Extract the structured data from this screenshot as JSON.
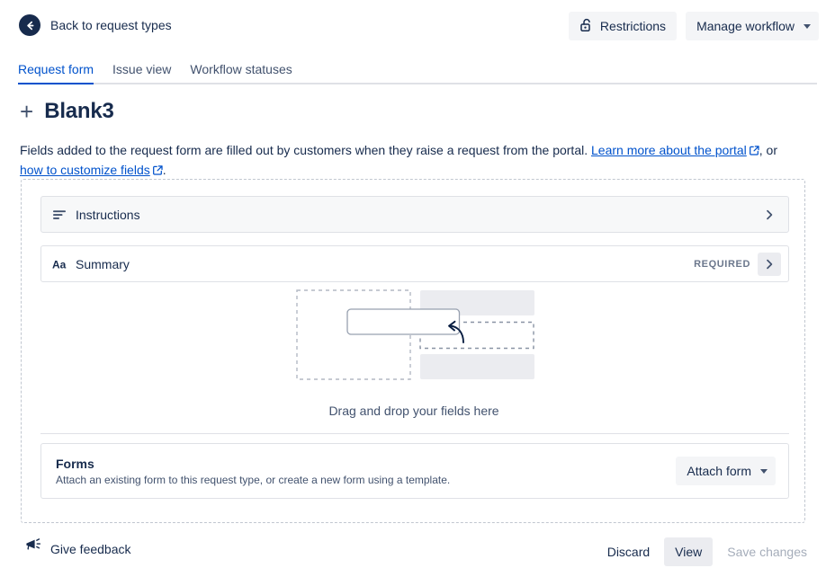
{
  "topbar": {
    "back_label": "Back to request types",
    "back_icon": "arrow-left-circle-icon",
    "restrictions_label": "Restrictions",
    "restrictions_icon": "unlock-icon",
    "manage_workflow_label": "Manage workflow",
    "manage_workflow_icon": "chevron-down-icon"
  },
  "tabs": [
    {
      "label": "Request form",
      "active": true
    },
    {
      "label": "Issue view",
      "active": false
    },
    {
      "label": "Workflow statuses",
      "active": false
    }
  ],
  "heading": {
    "plus_icon": "plus-icon",
    "title": "Blank3"
  },
  "description": {
    "part1": "Fields added to the request form are filled out by customers when they raise a request from the portal. ",
    "link1": "Learn more about the portal",
    "part2": ", or ",
    "link2": "how to customize fields",
    "part3": "."
  },
  "fields": [
    {
      "label": "Instructions",
      "icon": "paragraph-lines-icon",
      "required": "",
      "shaded": true,
      "chevron_icon": "chevron-right-icon"
    },
    {
      "label": "Summary",
      "icon": "text-aa-icon",
      "required": "REQUIRED",
      "shaded": false,
      "chevron_icon": "chevron-right-icon"
    }
  ],
  "dropzone": {
    "illustration_name": "drag-drop-illustration",
    "drag_text": "Drag and drop your fields here"
  },
  "forms": {
    "title": "Forms",
    "subtitle": "Attach an existing form to this request type, or create a new form using a template.",
    "attach_label": "Attach form",
    "attach_icon": "chevron-down-icon"
  },
  "bottombar": {
    "feedback_label": "Give feedback",
    "feedback_icon": "megaphone-icon",
    "discard_label": "Discard",
    "view_label": "View",
    "save_label": "Save changes"
  },
  "colors": {
    "accent": "#0052CC",
    "text": "#172B4D",
    "subtle_text": "#42526E",
    "border": "#DFE1E6",
    "button_bg": "#F4F5F7",
    "row_shaded": "#F7F8F9"
  }
}
